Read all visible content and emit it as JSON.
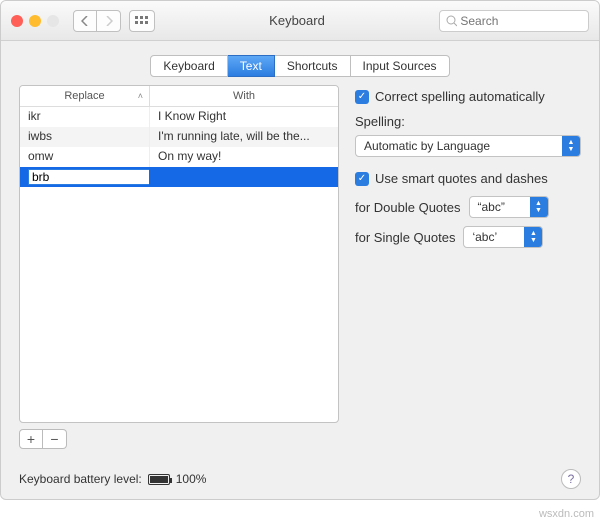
{
  "window_title": "Keyboard",
  "search_placeholder": "Search",
  "tabs": [
    "Keyboard",
    "Text",
    "Shortcuts",
    "Input Sources"
  ],
  "active_tab": 1,
  "columns": {
    "replace": "Replace",
    "with": "With"
  },
  "rows": [
    {
      "replace": "ikr",
      "with": "I Know Right"
    },
    {
      "replace": "iwbs",
      "with": "I'm running late, will be the..."
    },
    {
      "replace": "omw",
      "with": "On my way!"
    },
    {
      "replace": "brb",
      "with": "",
      "editing": true,
      "selected": true
    }
  ],
  "side": {
    "correct_spelling": {
      "label": "Correct spelling automatically",
      "checked": true
    },
    "spelling_label": "Spelling:",
    "spelling_value": "Automatic by Language",
    "smart_quotes": {
      "label": "Use smart quotes and dashes",
      "checked": true
    },
    "double_label": "for Double Quotes",
    "double_value": "“abc”",
    "single_label": "for Single Quotes",
    "single_value": "‘abc’"
  },
  "footer": {
    "battery_label": "Keyboard battery level:",
    "battery_pct": "100%"
  },
  "watermark": "wsxdn.com"
}
